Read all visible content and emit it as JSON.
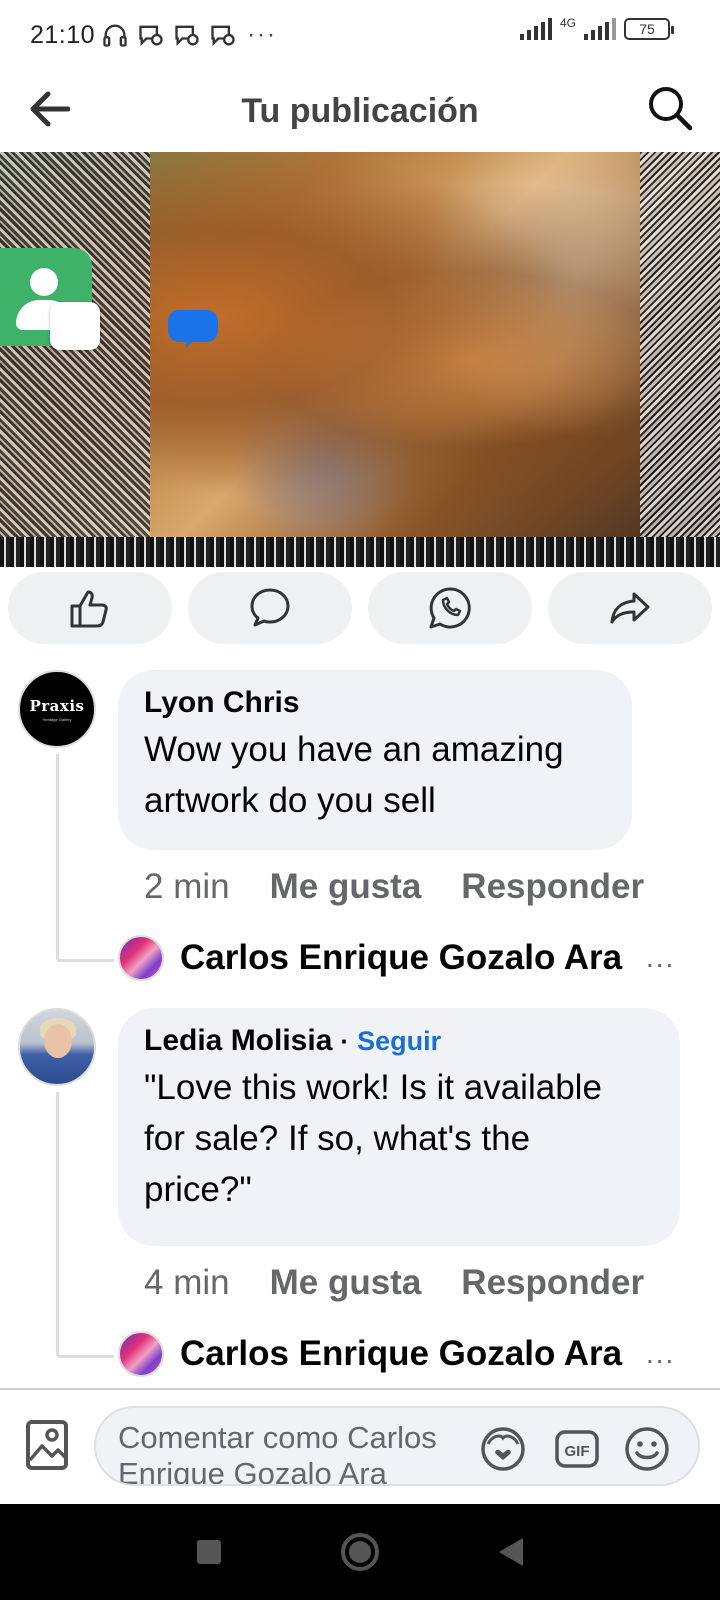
{
  "status_bar": {
    "time": "21:10",
    "dots": "···",
    "network": "4G",
    "battery": "75"
  },
  "header": {
    "title": "Tu publicación"
  },
  "post": {
    "actions": [
      "like-icon",
      "comment-icon",
      "whatsapp-icon",
      "share-icon"
    ]
  },
  "comments": [
    {
      "author": "Lyon Chris",
      "avatar_text": "Praxis",
      "avatar_subtext": "Heritage Gallery",
      "text_lines": [
        "Wow you have an amazing",
        "artwork do you sell"
      ],
      "time": "2 min",
      "like_label": "Me gusta",
      "reply_label": "Responder",
      "reply": {
        "name": "Carlos Enrique Gozalo Ara",
        "more": "..."
      }
    },
    {
      "author": "Ledia Molisia",
      "separator": "·",
      "follow_label": "Seguir",
      "text_lines": [
        "\"Love this work! Is it available",
        "for sale? If so, what's the",
        "price?\""
      ],
      "time": "4 min",
      "like_label": "Me gusta",
      "reply_label": "Responder",
      "reply": {
        "name": "Carlos Enrique Gozalo Ara",
        "more": "..."
      }
    }
  ],
  "composer": {
    "placeholder_lines": [
      "Comentar como Carlos",
      "Enrique Gozalo Ara"
    ]
  },
  "colors": {
    "follow": "#1b6ed3",
    "bubble": "#f0f2f5",
    "meta": "#65676b"
  }
}
